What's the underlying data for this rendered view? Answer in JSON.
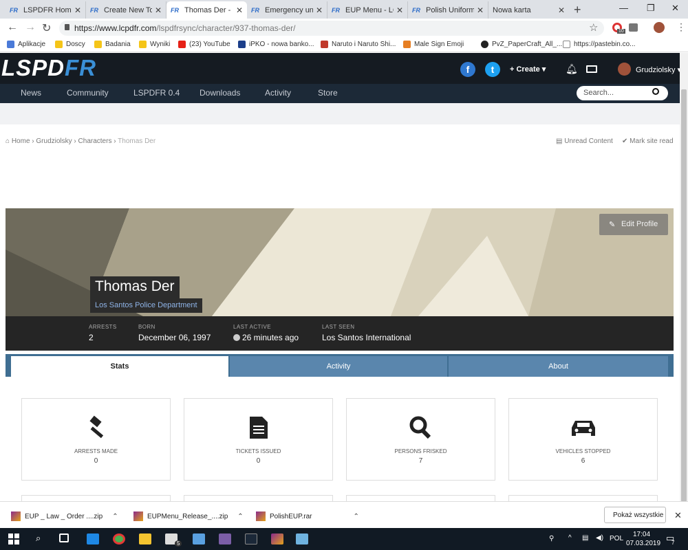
{
  "browser": {
    "tabs": [
      {
        "title": "LSPDFR Homepage"
      },
      {
        "title": "Create New Topic"
      },
      {
        "title": "Thomas Der - LCPDFR"
      },
      {
        "title": "Emergency uniforms"
      },
      {
        "title": "EUP Menu - LCPDFR"
      },
      {
        "title": "Polish Uniforms"
      },
      {
        "title": "Nowa karta"
      }
    ],
    "url_host": "https://www.lcpdfr.com",
    "url_path": "/lspdfrsync/character/937-thomas-der/",
    "extension_badge": "10",
    "bookmarks": [
      {
        "label": "Aplikacje",
        "color": "#4a7ad8"
      },
      {
        "label": "Doscy",
        "color": "#f5c518"
      },
      {
        "label": "Badania",
        "color": "#f5c518"
      },
      {
        "label": "Wyniki",
        "color": "#f5c518"
      },
      {
        "label": "(23) YouTube",
        "color": "#e62117"
      },
      {
        "label": "iPKO - nowa banko...",
        "color": "#1c3f8a"
      },
      {
        "label": "Naruto i Naruto Shi...",
        "color": "#c0392b"
      },
      {
        "label": "Male Sign Emoji",
        "color": "#e67e22"
      },
      {
        "label": "PvZ_PaperCraft_All_...",
        "color": "#222222"
      },
      {
        "label": "https://pastebin.co...",
        "color": "#888888"
      }
    ]
  },
  "site": {
    "logo_main": "LSPD",
    "logo_accent": "FR",
    "create_label": "Create",
    "user_name": "Grudziolsky",
    "nav": [
      "News",
      "Community",
      "LSPDFR 0.4",
      "Downloads",
      "Activity",
      "Store"
    ],
    "search_placeholder": "Search..."
  },
  "breadcrumb": {
    "items": [
      "Home",
      "Grudziolsky",
      "Characters",
      "Thomas Der"
    ],
    "unread": "Unread Content",
    "mark_read": "Mark site read"
  },
  "profile": {
    "edit_label": "Edit Profile",
    "name": "Thomas Der",
    "department": "Los Santos Police Department",
    "stats": [
      {
        "label": "ARRESTS",
        "value": "2"
      },
      {
        "label": "BORN",
        "value": "December 06, 1997"
      },
      {
        "label": "LAST ACTIVE",
        "value": "26 minutes ago"
      },
      {
        "label": "LAST SEEN",
        "value": "Los Santos International"
      }
    ],
    "tabs": [
      "Stats",
      "Activity",
      "About"
    ],
    "cards": [
      {
        "label": "ARRESTS MADE",
        "value": "0",
        "icon": "gavel-icon"
      },
      {
        "label": "TICKETS ISSUED",
        "value": "0",
        "icon": "document-icon"
      },
      {
        "label": "PERSONS FRISKED",
        "value": "7",
        "icon": "magnifier-icon"
      },
      {
        "label": "VEHICLES STOPPED",
        "value": "6",
        "icon": "car-icon"
      }
    ]
  },
  "downloads": {
    "items": [
      "EUP _ Law _ Order ....zip",
      "EUPMenu_Release_....zip",
      "PolishEUP.rar"
    ],
    "show_all": "Pokaż wszystkie"
  },
  "taskbar": {
    "lang": "POL",
    "time": "17:04",
    "date": "07.03.2019",
    "mail_badge": "5",
    "notif_badge": "7"
  }
}
